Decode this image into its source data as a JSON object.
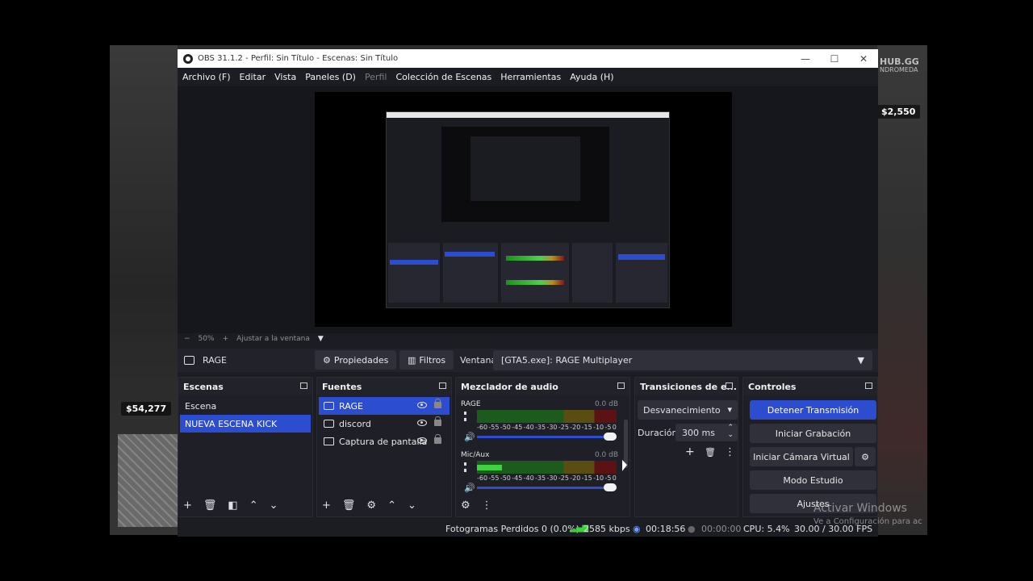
{
  "background": {
    "money_left": "$54,277",
    "money_right": "$2,550",
    "brand_main": "HUB.GG",
    "brand_sub": "NDROMEDA"
  },
  "window": {
    "title": "OBS 31.1.2 - Perfil: Sin Título - Escenas: Sin Título",
    "controls": [
      "—",
      "☐",
      "✕"
    ]
  },
  "menu": {
    "items": [
      "Archivo (F)",
      "Editar",
      "Vista",
      "Paneles (D)",
      "Perfil",
      "Colección de Escenas",
      "Herramientas",
      "Ayuda (H)"
    ]
  },
  "zoom": {
    "minus": "−",
    "level": "50%",
    "plus": "+",
    "fit": "Ajustar a la ventana",
    "caret": "▼"
  },
  "source_bar": {
    "source_name": "RAGE",
    "properties": "Propiedades",
    "filters": "Filtros",
    "window_label": "Ventana",
    "window_value": "[GTA5.exe]: RAGE Multiplayer",
    "caret": "▼"
  },
  "scenes": {
    "title": "Escenas",
    "items": [
      "Escena",
      "NUEVA ESCENA KICK"
    ],
    "selected": 1
  },
  "sources": {
    "title": "Fuentes",
    "items": [
      "RAGE",
      "discord",
      "Captura de pantalla"
    ],
    "selected": 0
  },
  "mixer": {
    "title": "Mezclador de audio",
    "scale": [
      "-60",
      "-55",
      "-50",
      "-45",
      "-40",
      "-35",
      "-30",
      "-25",
      "-20",
      "-15",
      "-10",
      "-5",
      "0"
    ],
    "channels": [
      {
        "name": "RAGE",
        "db": "0.0 dB",
        "level": 0.0
      },
      {
        "name": "Mic/Aux",
        "db": "0.0 dB",
        "level": 0.18
      }
    ]
  },
  "transitions": {
    "title": "Transiciones de e...",
    "type": "Desvanecimiento",
    "duration_label": "Duración",
    "duration_value": "300 ms"
  },
  "controls": {
    "title": "Controles",
    "stop_stream": "Detener Transmisión",
    "start_record": "Iniciar Grabación",
    "start_vcam": "Iniciar Cámara Virtual",
    "studio_mode": "Modo Estudio",
    "settings": "Ajustes"
  },
  "status": {
    "dropped": "Fotogramas Perdidos 0 (0.0%)",
    "bitrate": "2585 kbps",
    "stream_time": "00:18:56",
    "record_time": "00:00:00",
    "cpu": "CPU: 5.4%",
    "fps": "30.00 / 30.00 FPS"
  },
  "watermark": {
    "title": "Activar Windows",
    "sub": "Ve a Configuración para ac"
  },
  "colors": {
    "accent": "#2c4dcf",
    "panel": "#1f2027",
    "meter_green": "#3fd13f"
  }
}
